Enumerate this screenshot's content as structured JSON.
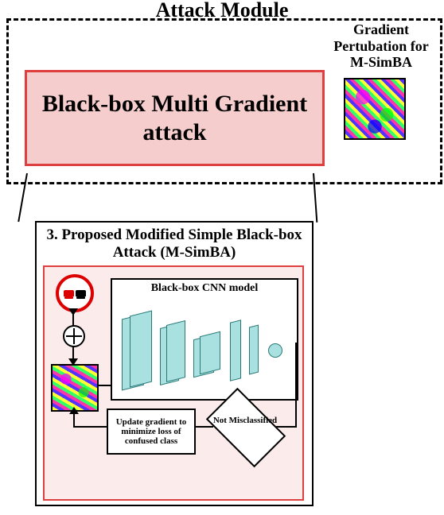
{
  "module_title": "Attack Module",
  "perturbation_label": "Gradient Pertubation for M-SimBA",
  "banner_text": "Black-box Multi Gradient attack",
  "lower_title": "3. Proposed Modified Simple Black-box Attack (M-SimBA)",
  "cnn_title": "Black-box CNN model",
  "update_box_text": "Update gradient to minimize loss of confused class",
  "diamond_text": "Not Misclassified"
}
